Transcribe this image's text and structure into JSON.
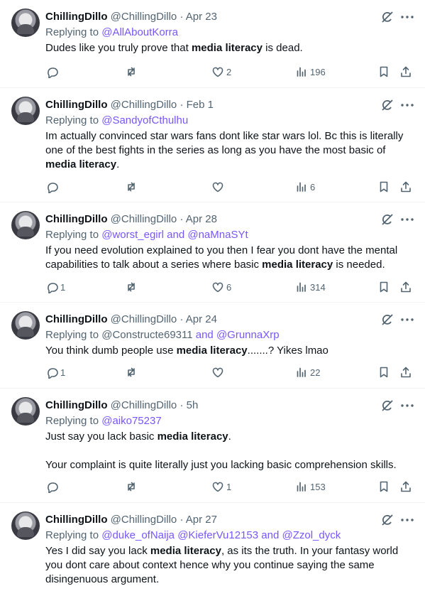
{
  "tweets": [
    {
      "name": "ChillingDillo",
      "handle": "@ChillingDillo",
      "time": "Apr 23",
      "replying_prefix": "Replying to ",
      "reply_parts": [
        {
          "text": "@AllAboutKorra",
          "link": true
        }
      ],
      "paragraphs": [
        [
          {
            "t": "Dudes like you truly prove that "
          },
          {
            "t": "media literacy",
            "b": true
          },
          {
            "t": " is dead."
          }
        ]
      ],
      "stats": {
        "replies": "",
        "retweets": "",
        "likes": "2",
        "views": "196"
      }
    },
    {
      "name": "ChillingDillo",
      "handle": "@ChillingDillo",
      "time": "Feb 1",
      "replying_prefix": "Replying to ",
      "reply_parts": [
        {
          "text": "@SandyofCthulhu",
          "link": true
        }
      ],
      "paragraphs": [
        [
          {
            "t": "Im actually convinced star wars fans dont like star wars lol. Bc this is literally one of the best fights in the series as long as you have the most basic of "
          },
          {
            "t": "media literacy",
            "b": true
          },
          {
            "t": "."
          }
        ]
      ],
      "stats": {
        "replies": "",
        "retweets": "",
        "likes": "",
        "views": "6"
      }
    },
    {
      "name": "ChillingDillo",
      "handle": "@ChillingDillo",
      "time": "Apr 28",
      "replying_prefix": "Replying to ",
      "reply_parts": [
        {
          "text": "@worst_egirl",
          "link": true
        },
        {
          "text": " and ",
          "link": true
        },
        {
          "text": "@naMnaSYt",
          "link": true
        }
      ],
      "paragraphs": [
        [
          {
            "t": "If you need evolution explained to you then I fear you dont have the mental capabilities to talk about a series where basic "
          },
          {
            "t": "media literacy",
            "b": true
          },
          {
            "t": " is needed."
          }
        ]
      ],
      "stats": {
        "replies": "1",
        "retweets": "",
        "likes": "6",
        "views": "314"
      }
    },
    {
      "name": "ChillingDillo",
      "handle": "@ChillingDillo",
      "time": "Apr 24",
      "replying_prefix": "Replying to ",
      "reply_parts": [
        {
          "text": "@Constructe69311",
          "link": false
        },
        {
          "text": " and ",
          "link": true
        },
        {
          "text": "@GrunnaXrp",
          "link": true
        }
      ],
      "paragraphs": [
        [
          {
            "t": "You think dumb people use "
          },
          {
            "t": "media literacy",
            "b": true
          },
          {
            "t": ".......? Yikes lmao"
          }
        ]
      ],
      "stats": {
        "replies": "1",
        "retweets": "",
        "likes": "",
        "views": "22"
      }
    },
    {
      "name": "ChillingDillo",
      "handle": "@ChillingDillo",
      "time": "5h",
      "replying_prefix": "Replying to ",
      "reply_parts": [
        {
          "text": "@aiko75237",
          "link": true
        }
      ],
      "paragraphs": [
        [
          {
            "t": "Just say you lack basic "
          },
          {
            "t": "media literacy",
            "b": true
          },
          {
            "t": "."
          }
        ],
        [
          {
            "t": "Your complaint is quite literally just you lacking basic comprehension skills."
          }
        ]
      ],
      "stats": {
        "replies": "",
        "retweets": "",
        "likes": "1",
        "views": "153"
      }
    },
    {
      "name": "ChillingDillo",
      "handle": "@ChillingDillo",
      "time": "Apr 27",
      "replying_prefix": "Replying to ",
      "reply_parts": [
        {
          "text": "@duke_ofNaija",
          "link": true
        },
        {
          "text": " ",
          "link": true
        },
        {
          "text": "@KieferVu12153",
          "link": true
        },
        {
          "text": " and ",
          "link": true
        },
        {
          "text": "@Zzol_dyck",
          "link": true
        }
      ],
      "paragraphs": [
        [
          {
            "t": "Yes I did say you lack "
          },
          {
            "t": "media literacy",
            "b": true
          },
          {
            "t": ", as its the truth. In your fantasy world you dont care about context hence why you continue saying the same disingenuous argument."
          }
        ]
      ],
      "stats": {
        "replies": "",
        "retweets": "",
        "likes": "",
        "views": ""
      }
    }
  ],
  "separator": "·",
  "colors": {
    "mention": "#7856ff",
    "muted": "#536471",
    "text": "#0f1419",
    "divider": "#eff3f4"
  }
}
